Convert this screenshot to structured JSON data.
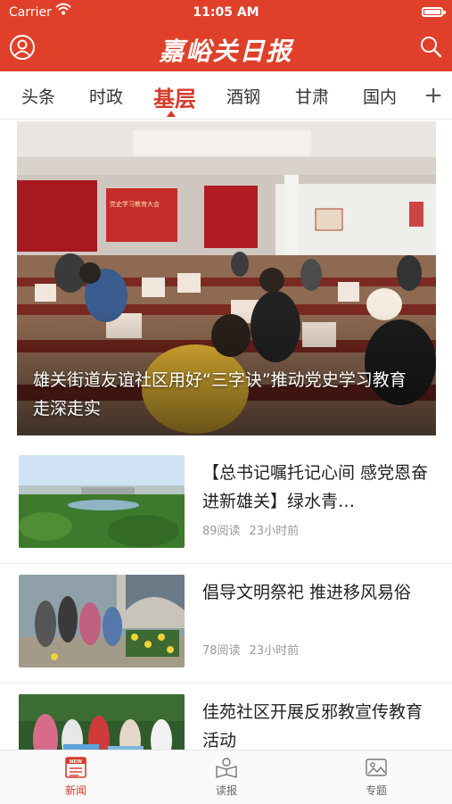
{
  "status_bar": {
    "carrier": "Carrier",
    "time": "11:05 AM"
  },
  "header": {
    "brand": "嘉峪关日报"
  },
  "tabs": [
    {
      "label": "头条"
    },
    {
      "label": "时政"
    },
    {
      "label": "基层"
    },
    {
      "label": "酒钢"
    },
    {
      "label": "甘肃"
    },
    {
      "label": "国内"
    }
  ],
  "tab_add": "+",
  "hero": {
    "caption": "雄关街道友谊社区用好“三字诀”推动党史学习教育走深走实",
    "banner_text": "党史学习教育大会"
  },
  "news": [
    {
      "title": "【总书记嘱托记心间 感党恩奋进新雄关】绿水青…",
      "reads": "89阅读",
      "time": "23小时前"
    },
    {
      "title": "倡导文明祭祀 推进移风易俗",
      "reads": "78阅读",
      "time": "23小时前"
    },
    {
      "title": "佳苑社区开展反邪教宣传教育活动",
      "reads": "",
      "time": ""
    }
  ],
  "bottom_nav": [
    {
      "label": "新闻",
      "badge": "NEW"
    },
    {
      "label": "读报"
    },
    {
      "label": "专题"
    }
  ],
  "colors": {
    "brand_red": "#e0402a",
    "active_red": "#d73a2a"
  }
}
